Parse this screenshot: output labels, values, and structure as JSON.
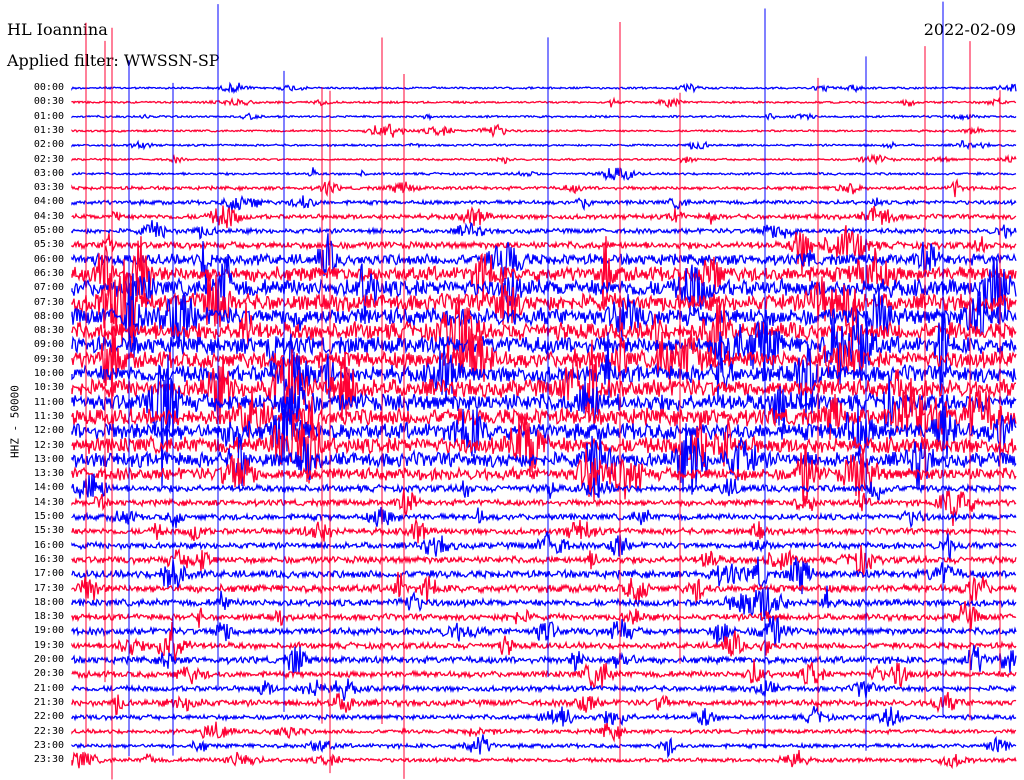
{
  "header": {
    "station": "HL Ioannina",
    "filter": "Applied filter: WWSSN-SP",
    "date": "2022-02-09"
  },
  "chart_data": {
    "type": "helicorder",
    "title": "HL Ioannina",
    "ylabel": "HHZ - 50000",
    "row_minutes": 30,
    "colors": [
      "#0000ff",
      "#ff0033"
    ],
    "row_labels": [
      "00:00",
      "00:30",
      "01:00",
      "01:30",
      "02:00",
      "02:30",
      "03:00",
      "03:30",
      "04:00",
      "04:30",
      "05:00",
      "05:30",
      "06:00",
      "06:30",
      "07:00",
      "07:30",
      "08:00",
      "08:30",
      "09:00",
      "09:30",
      "10:00",
      "10:30",
      "11:00",
      "11:30",
      "12:00",
      "12:30",
      "13:00",
      "13:30",
      "14:00",
      "14:30",
      "15:00",
      "15:30",
      "16:00",
      "16:30",
      "17:00",
      "17:30",
      "18:00",
      "18:30",
      "19:00",
      "19:30",
      "20:00",
      "20:30",
      "21:00",
      "21:30",
      "22:00",
      "22:30",
      "23:00",
      "23:30"
    ],
    "relative_amplitude": [
      0.3,
      0.3,
      0.3,
      0.3,
      0.3,
      0.3,
      0.35,
      0.5,
      0.6,
      0.7,
      0.7,
      1.0,
      1.6,
      2.2,
      2.5,
      2.5,
      2.6,
      2.6,
      2.6,
      2.5,
      2.5,
      2.6,
      2.6,
      2.5,
      2.5,
      2.4,
      2.2,
      1.8,
      1.0,
      0.9,
      0.9,
      0.9,
      0.9,
      1.0,
      1.1,
      1.1,
      1.0,
      0.9,
      1.0,
      0.9,
      1.0,
      0.9,
      0.8,
      0.9,
      0.7,
      0.6,
      0.6,
      0.6
    ]
  }
}
